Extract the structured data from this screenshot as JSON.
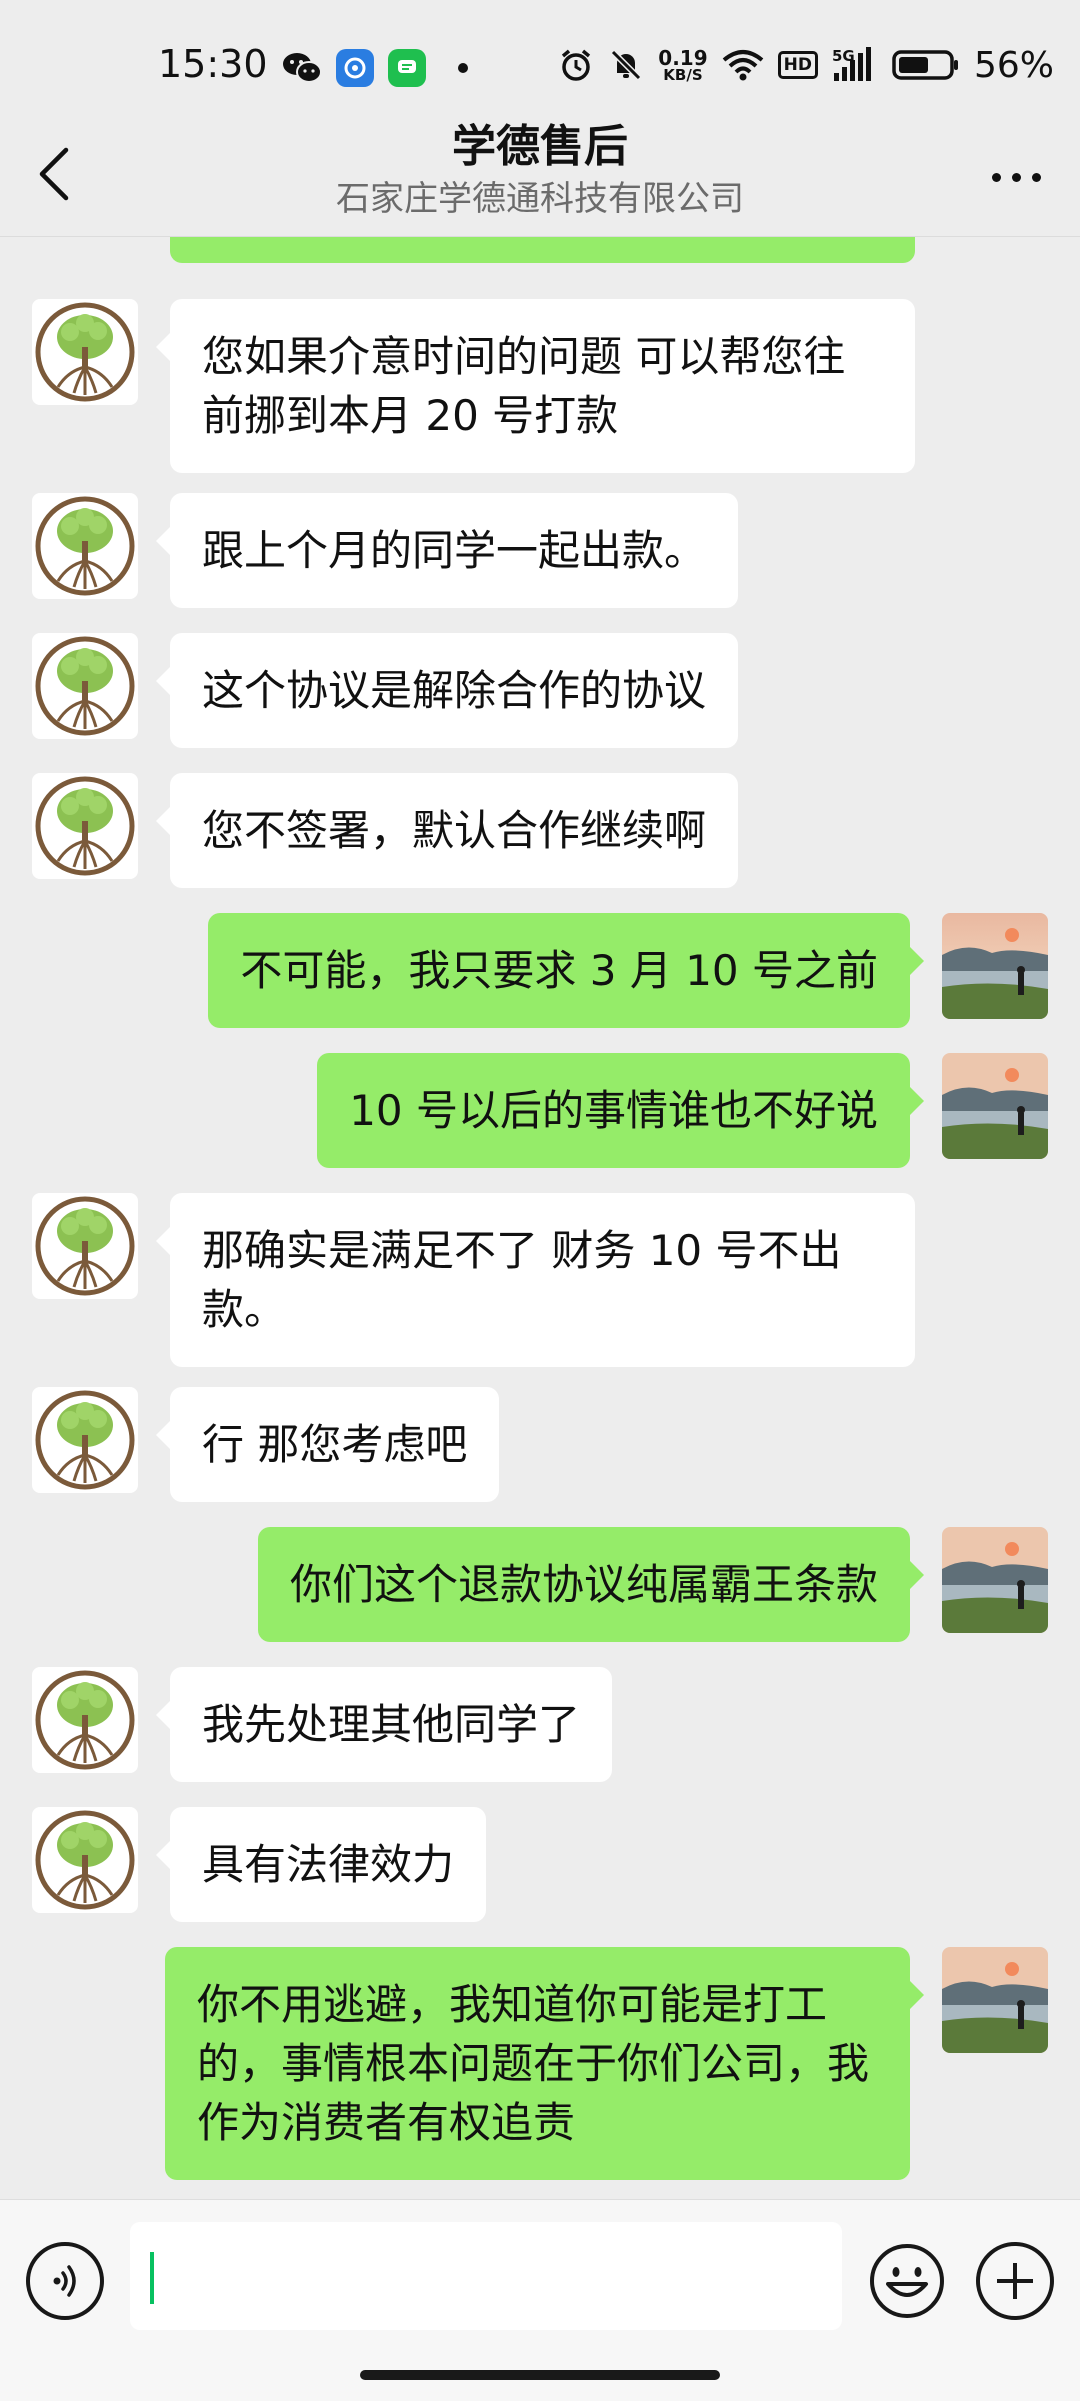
{
  "status_bar": {
    "time": "15:30",
    "net_speed_value": "0.19",
    "net_speed_unit": "KB/S",
    "hd_label": "HD",
    "signal_label": "5G",
    "battery_percent": "56%",
    "icons": [
      "wechat-icon",
      "browser-icon",
      "message-app-icon",
      "alarm-icon",
      "mute-icon",
      "wifi-icon",
      "hd-icon",
      "signal-icon",
      "battery-icon"
    ]
  },
  "header": {
    "title": "学德售后",
    "subtitle": "石家庄学德通科技有限公司"
  },
  "messages": [
    {
      "side": "in",
      "text": "您如果介意时间的问题 可以帮您往前挪到本月 20 号打款"
    },
    {
      "side": "in",
      "text": "跟上个月的同学一起出款。"
    },
    {
      "side": "in",
      "text": "这个协议是解除合作的协议"
    },
    {
      "side": "in",
      "text": "您不签署，默认合作继续啊"
    },
    {
      "side": "out",
      "text": "不可能，我只要求 3 月 10 号之前"
    },
    {
      "side": "out",
      "text": "10 号以后的事情谁也不好说"
    },
    {
      "side": "in",
      "text": "那确实是满足不了 财务 10 号不出款。"
    },
    {
      "side": "in",
      "text": "行 那您考虑吧"
    },
    {
      "side": "out",
      "text": "你们这个退款协议纯属霸王条款"
    },
    {
      "side": "in",
      "text": "我先处理其他同学了"
    },
    {
      "side": "in",
      "text": "具有法律效力"
    },
    {
      "side": "out",
      "text": "你不用逃避，我知道你可能是打工的，事情根本问题在于你们公司，我作为消费者有权追责"
    }
  ],
  "input": {
    "value": ""
  },
  "colors": {
    "background": "#ededed",
    "incoming_bubble": "#ffffff",
    "outgoing_bubble": "#95ec69",
    "caret": "#07c160"
  }
}
